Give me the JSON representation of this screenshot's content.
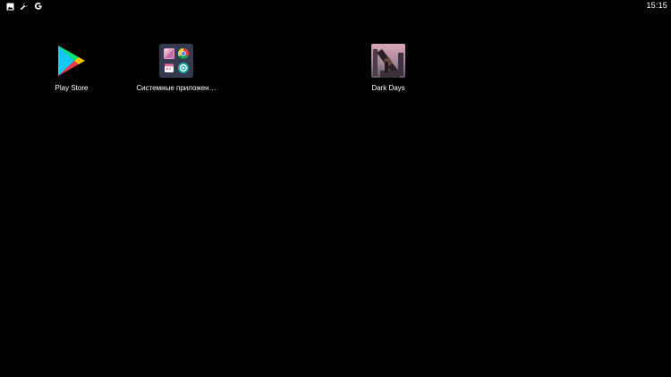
{
  "status_bar": {
    "time": "15:15",
    "icons": [
      "gallery-icon",
      "wrench-icon",
      "google-icon"
    ]
  },
  "apps": [
    {
      "label": "Play Store",
      "icon": "play-store-icon"
    },
    {
      "label": "Системные приложен…",
      "icon": "folder-icon",
      "folder_contents": [
        "gallery-app-icon",
        "chrome-icon",
        "calendar-app-icon",
        "settings-gear-icon"
      ]
    },
    {
      "label": "Dark Days",
      "icon": "dark-days-icon"
    }
  ],
  "colors": {
    "background": "#000000",
    "text": "#ffffff",
    "folder": "#333a4f"
  }
}
